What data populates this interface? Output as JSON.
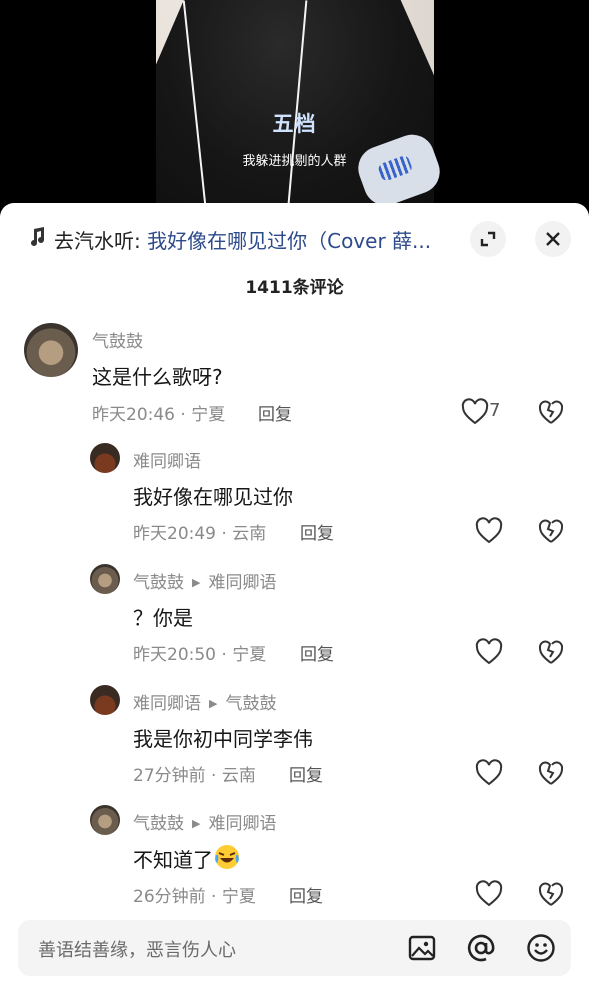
{
  "video": {
    "subtitle_main": "五档",
    "subtitle_lyric": "我躲进挑剔的人群"
  },
  "music": {
    "prefix": "去汽水听: ",
    "song": "我好像在哪见过你（Cover 薛..."
  },
  "comments_count": "1411条评论",
  "comments": [
    {
      "user": "气鼓鼓",
      "reply_to": "",
      "text": "这是什么歌呀?",
      "time": "昨天20:46",
      "location": "宁夏",
      "reply_label": "回复",
      "likes": "7"
    },
    {
      "user": "难同卿语",
      "reply_to": "",
      "text": "我好像在哪见过你",
      "time": "昨天20:49",
      "location": "云南",
      "reply_label": "回复"
    },
    {
      "user": "气鼓鼓",
      "reply_to": "难同卿语",
      "text": "？你是",
      "time": "昨天20:50",
      "location": "宁夏",
      "reply_label": "回复"
    },
    {
      "user": "难同卿语",
      "reply_to": "气鼓鼓",
      "text": "我是你初中同学李伟",
      "time": "27分钟前",
      "location": "云南",
      "reply_label": "回复"
    },
    {
      "user": "气鼓鼓",
      "reply_to": "难同卿语",
      "text": "不知道了",
      "time": "26分钟前",
      "location": "宁夏",
      "reply_label": "回复",
      "emoji": "laughing-crying-emoji"
    }
  ],
  "input": {
    "placeholder": "善语结善缘，恶言伤人心"
  },
  "icons": {
    "music": "music-note-icon",
    "expand": "expand-icon",
    "close": "close-icon",
    "like": "heart-icon",
    "dislike": "broken-heart-icon",
    "image": "image-icon",
    "mention": "at-icon",
    "emoji": "smiley-icon"
  },
  "colors": {
    "song_link": "#2d4a8a",
    "meta_gray": "#8a8a8a",
    "subtitle": "#cfe3ff"
  }
}
